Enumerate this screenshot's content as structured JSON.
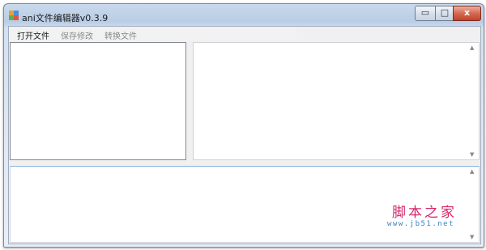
{
  "window": {
    "title": "ani文件编辑器v0.3.9"
  },
  "title_controls": {
    "minimize": "▭",
    "maximize": "□",
    "close": "x"
  },
  "menu": {
    "items": [
      {
        "label": "打开文件",
        "enabled": true
      },
      {
        "label": "保存修改",
        "enabled": false
      },
      {
        "label": "转换文件",
        "enabled": false
      }
    ]
  },
  "scroll": {
    "up": "▲",
    "down": "▼"
  },
  "watermark": {
    "title": "脚本之家",
    "url": "www.jb51.net"
  },
  "colors": {
    "watermark_title": "#d7266a",
    "watermark_url": "#3a82c4",
    "close_button": "#c0432a"
  }
}
